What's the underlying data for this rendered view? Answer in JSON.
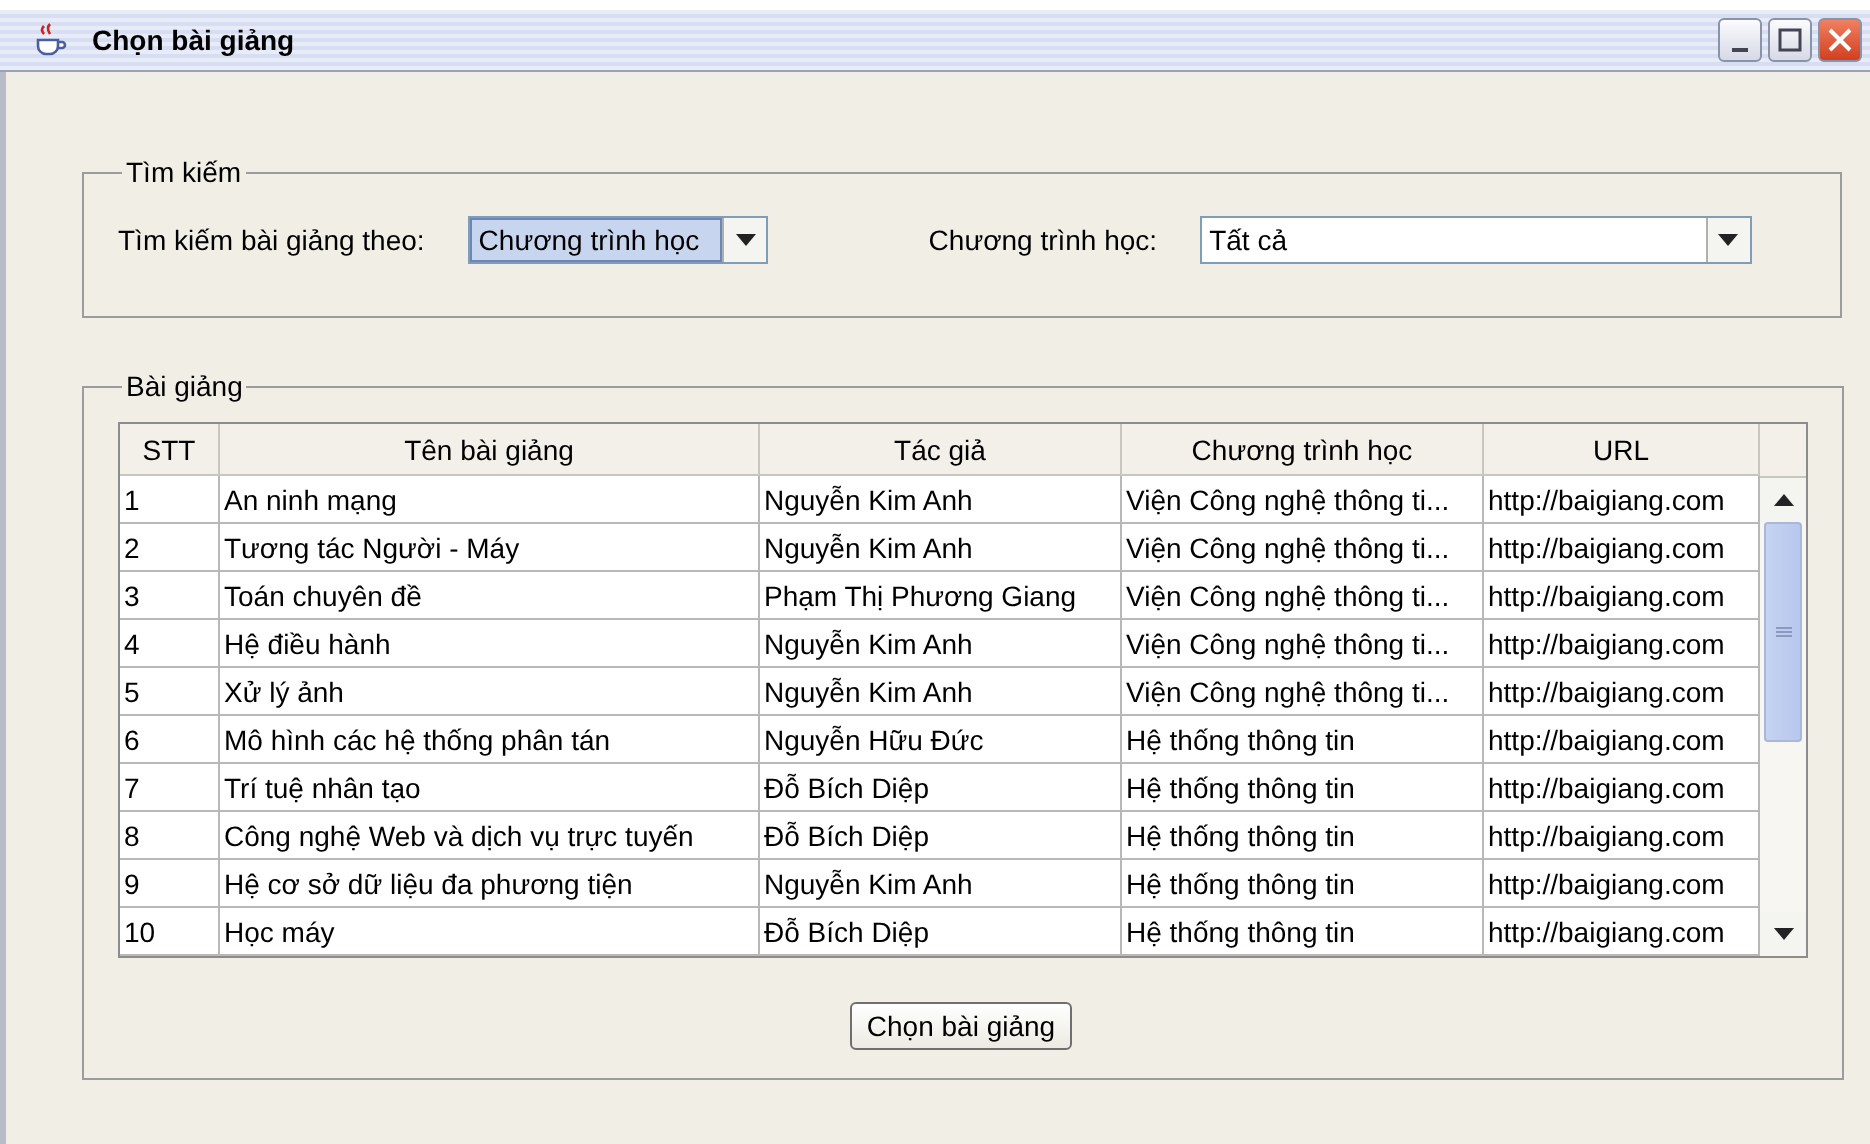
{
  "window": {
    "title": "Chọn bài giảng"
  },
  "search": {
    "legend": "Tìm kiếm",
    "by": {
      "label": "Tìm kiếm bài giảng theo:",
      "value": "Chương trình học",
      "focused": true
    },
    "program": {
      "label": "Chương trình học:",
      "value": "Tất cả",
      "focused": false
    }
  },
  "lectures": {
    "legend": "Bài giảng",
    "columns": [
      "STT",
      "Tên bài giảng",
      "Tác giả",
      "Chương trình học",
      "URL"
    ],
    "rows": [
      [
        "1",
        "An ninh mạng",
        "Nguyễn Kim Anh",
        "Viện Công nghệ thông ti...",
        "http://baigiang.com"
      ],
      [
        "2",
        "Tương tác Người - Máy",
        "Nguyễn Kim Anh",
        "Viện Công nghệ thông ti...",
        "http://baigiang.com"
      ],
      [
        "3",
        "Toán chuyên đề",
        "Phạm Thị Phương Giang",
        "Viện Công nghệ thông ti...",
        "http://baigiang.com"
      ],
      [
        "4",
        "Hệ điều hành",
        "Nguyễn Kim Anh",
        "Viện Công nghệ thông ti...",
        "http://baigiang.com"
      ],
      [
        "5",
        "Xử lý ảnh",
        "Nguyễn Kim Anh",
        "Viện Công nghệ thông ti...",
        "http://baigiang.com"
      ],
      [
        "6",
        "Mô hình các hệ thống phân tán",
        "Nguyễn Hữu Đức",
        "Hệ thống thông tin",
        "http://baigiang.com"
      ],
      [
        "7",
        "Trí tuệ nhân tạo",
        "Đỗ Bích Diệp",
        "Hệ thống thông tin",
        "http://baigiang.com"
      ],
      [
        "8",
        "Công nghệ Web và dịch vụ trực tuyến",
        "Đỗ Bích Diệp",
        "Hệ thống thông tin",
        "http://baigiang.com"
      ],
      [
        "9",
        "Hệ cơ sở dữ liệu đa phương tiện",
        "Nguyễn Kim Anh",
        "Hệ thống thông tin",
        "http://baigiang.com"
      ],
      [
        "10",
        "Học máy",
        "Đỗ Bích Diệp",
        "Hệ thống thông tin",
        "http://baigiang.com"
      ]
    ]
  },
  "button": "Chọn bài giảng"
}
